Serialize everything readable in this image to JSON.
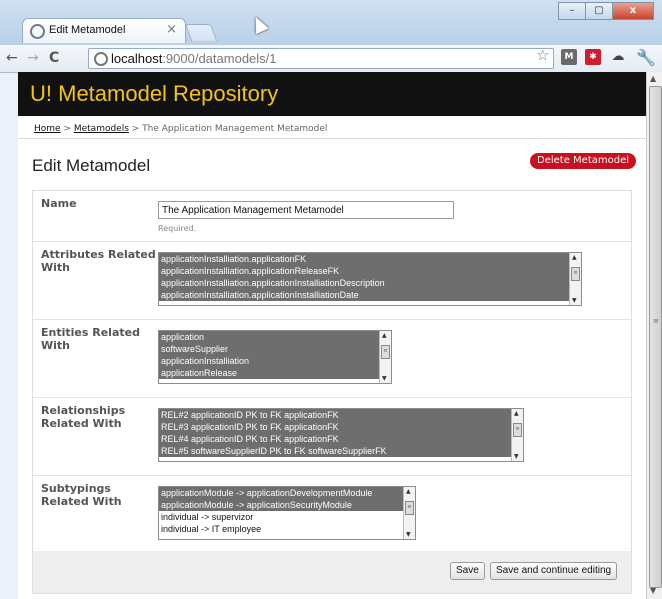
{
  "browser": {
    "tab_title": "Edit Metamodel",
    "tab_close": "×",
    "url_host": "localhost",
    "url_rest": ":9000/datamodels/1",
    "back_icon": "back-arrow-icon",
    "forward_icon": "forward-arrow-icon",
    "reload_icon": "reload-icon",
    "window_buttons": {
      "minimize": "–",
      "maximize": "▢",
      "close": "x"
    }
  },
  "site": {
    "title": "U! Metamodel Repository",
    "title_color": "#f2c31b"
  },
  "breadcrumb": {
    "home": "Home",
    "sep1": " > ",
    "metamodels": "Metamodels",
    "sep2": " > ",
    "current": "The Application Management Metamodel"
  },
  "page": {
    "title": "Edit Metamodel",
    "delete_button": "Delete Metamodel",
    "delete_color": "#c8101e"
  },
  "form": {
    "name": {
      "label": "Name",
      "value": "The Application Management Metamodel",
      "help": "Required."
    },
    "attributes": {
      "label": "Attributes Related With",
      "options": [
        "applicationInstalliation.applicationFK",
        "applicationInstalliation.applicationReleaseFK",
        "applicationInstalliation.applicationInstalliationDescription",
        "applicationInstalliation.applicationInstalliationDate"
      ]
    },
    "entities": {
      "label": "Entities Related With",
      "options": [
        "application",
        "softwareSupplier",
        "applicationInstalliation",
        "applicationRelease"
      ]
    },
    "relationships": {
      "label": "Relationships Related With",
      "options": [
        "REL#2 applicationID PK to FK applicationFK",
        "REL#3 applicationID PK to FK applicationFK",
        "REL#4 applicationID PK to FK applicationFK",
        "REL#5 softwareSupplierID PK to FK softwareSupplierFK"
      ]
    },
    "subtypings": {
      "label": "Subtypings Related With",
      "options": [
        "applicationModule -> applicationDevelopmentModule",
        "applicationModule -> applicationSecurityModule",
        "individual -> supervizor",
        "individual -> IT employee"
      ]
    },
    "save_button": "Save",
    "save_continue_button": "Save and continue editing"
  }
}
